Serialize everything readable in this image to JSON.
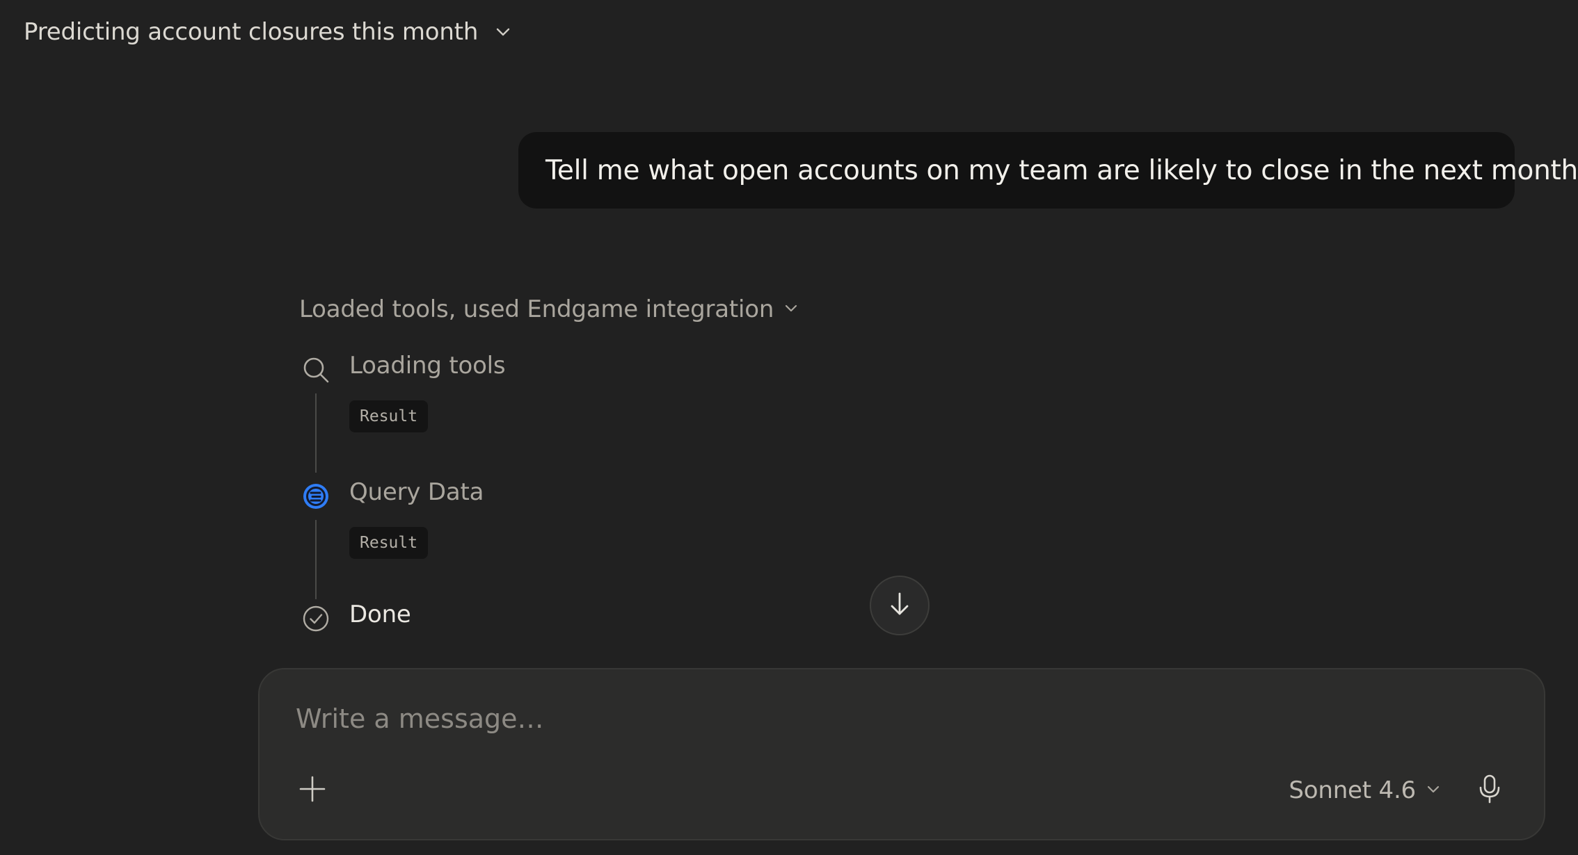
{
  "header": {
    "title": "Predicting account closures this month",
    "title_icon": "chevron-down-icon"
  },
  "conversation": {
    "user_message": "Tell me what open accounts on my team are likely to close in the next month"
  },
  "tool_run": {
    "summary": "Loaded tools, used Endgame integration",
    "summary_icon": "chevron-down-icon",
    "steps": [
      {
        "label": "Loading tools",
        "icon": "search-icon",
        "result_label": "Result"
      },
      {
        "label": "Query Data",
        "icon": "endgame-logo-icon",
        "result_label": "Result"
      },
      {
        "label": "Done",
        "icon": "check-circle-icon"
      }
    ]
  },
  "scroll_button": {
    "icon": "arrow-down-icon"
  },
  "composer": {
    "placeholder": "Write a message…",
    "value": "",
    "add_icon": "plus-icon",
    "model": "Sonnet 4.6",
    "model_icon": "chevron-down-icon",
    "mic_icon": "microphone-icon"
  },
  "colors": {
    "background": "#212121",
    "bubble": "#121212",
    "composer": "#2c2c2b",
    "accent_blue": "#2f7df6"
  }
}
